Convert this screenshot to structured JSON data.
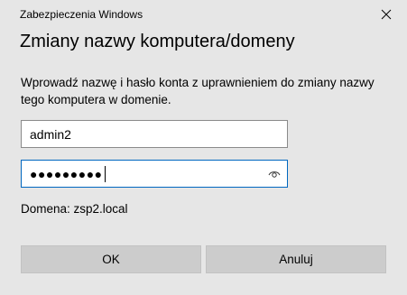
{
  "window": {
    "title": "Zabezpieczenia Windows",
    "close_icon": "close-icon"
  },
  "dialog": {
    "heading": "Zmiany nazwy komputera/domeny",
    "description": "Wprowadź nazwę i hasło konta z uprawnieniem do zmiany nazwy tego komputera w domenie."
  },
  "form": {
    "username_value": "admin2",
    "password_masked": "●●●●●●●●●",
    "reveal_icon": "eye-icon",
    "domain_text": "Domena: zsp2.local"
  },
  "buttons": {
    "ok_label": "OK",
    "cancel_label": "Anuluj"
  },
  "colors": {
    "background": "#e6e6e6",
    "focus_border": "#0067c0",
    "button_bg": "#cccccc"
  }
}
